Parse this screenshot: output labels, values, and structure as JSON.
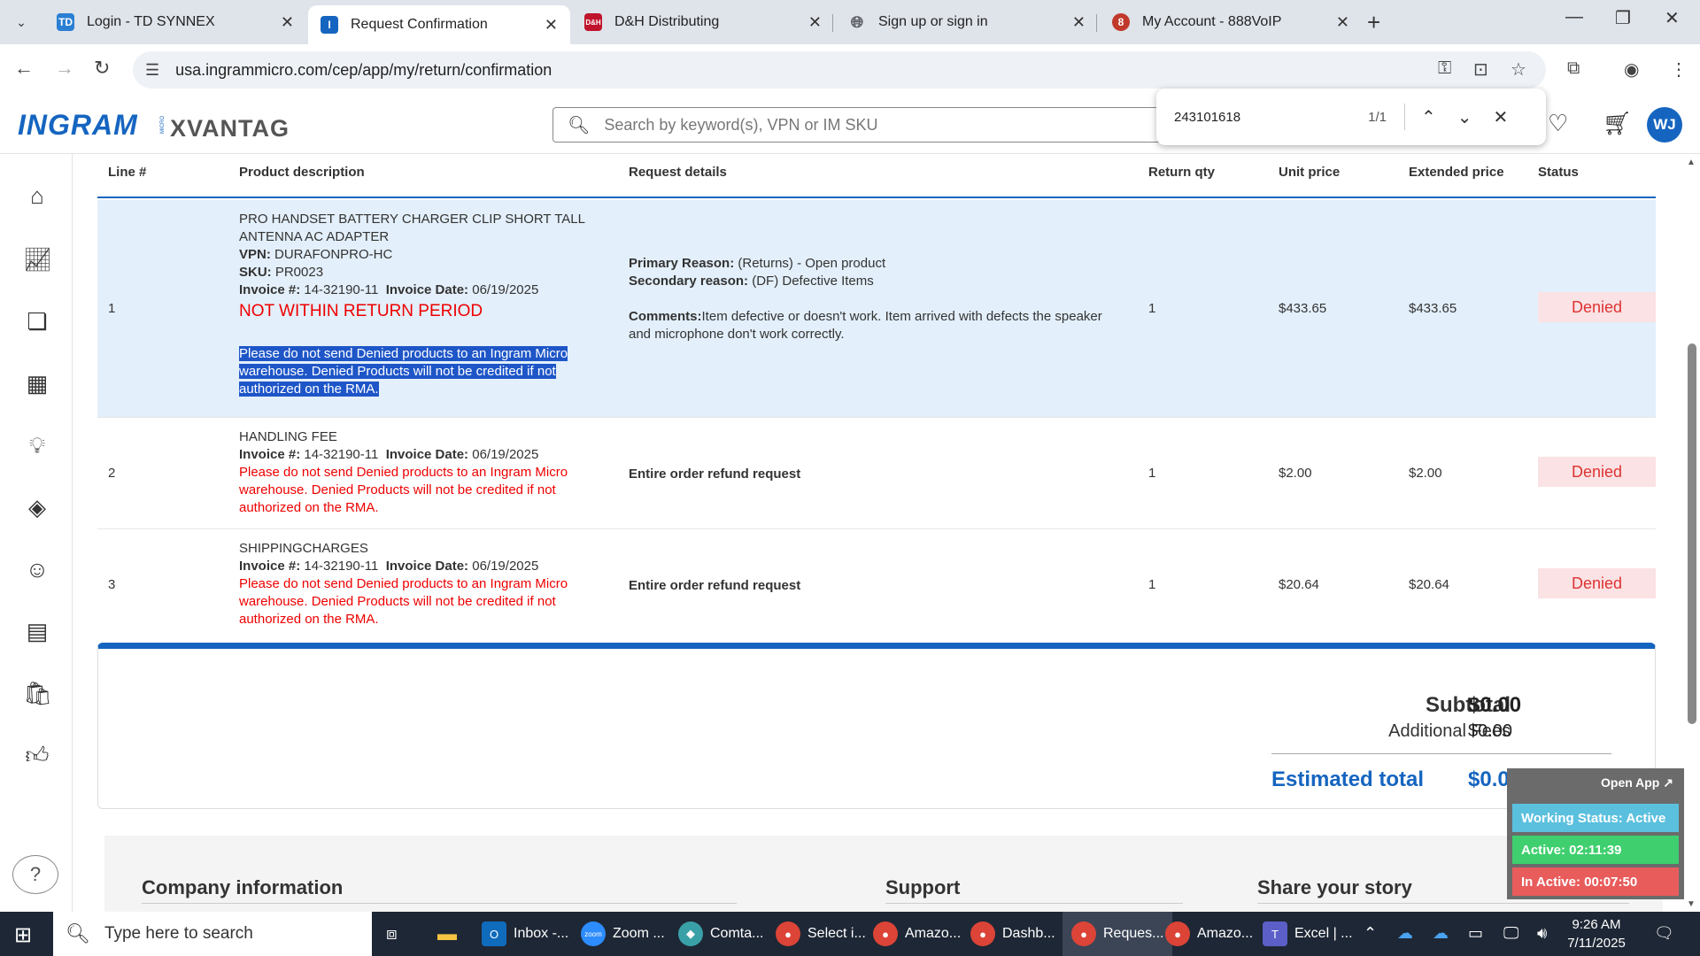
{
  "browser": {
    "tabs": [
      {
        "title": "Login - TD SYNNEX",
        "fav": "TD",
        "favcolor": "#2a7fd4"
      },
      {
        "title": "Request Confirmation",
        "fav": "I",
        "favcolor": "#1565c0"
      },
      {
        "title": "D&H Distributing",
        "fav": "D&H",
        "favcolor": "#c0142c"
      },
      {
        "title": "Sign up or sign in",
        "fav": "globe",
        "favcolor": "#5f6368"
      },
      {
        "title": "My Account - 888VoIP",
        "fav": "8",
        "favcolor": "#c0392b"
      }
    ],
    "url": "usa.ingrammicro.com/cep/app/my/return/confirmation"
  },
  "app": {
    "search_placeholder": "Search by keyword(s), VPN or IM SKU",
    "avatar": "WJ"
  },
  "find": {
    "query": "243101618",
    "count": "1/1"
  },
  "table": {
    "headers": {
      "line": "Line #",
      "desc": "Product description",
      "req": "Request details",
      "qty": "Return qty",
      "unit": "Unit price",
      "ext": "Extended price",
      "status": "Status"
    },
    "rows": [
      {
        "line": "1",
        "name": "PRO HANDSET BATTERY CHARGER CLIP SHORT TALL ANTENNA AC ADAPTER",
        "vpn_label": "VPN:",
        "vpn": "DURAFONPRO-HC",
        "sku_label": "SKU:",
        "sku": "PR0023",
        "inv_label": "Invoice #:",
        "inv": "14-32190-11",
        "date_label": "Invoice Date:",
        "date": "06/19/2025",
        "period": "NOT WITHIN RETURN PERIOD",
        "warning": "Please do not send Denied products to an Ingram Micro warehouse. Denied Products will not be credited if not authorized on the RMA.",
        "primary_label": "Primary Reason:",
        "primary": "(Returns) - Open product",
        "secondary_label": "Secondary reason:",
        "secondary": "(DF) Defective Items",
        "comments_label": "Comments:",
        "comments": "Item defective or doesn't work. Item arrived with defects the speaker and microphone don't work correctly.",
        "qty": "1",
        "unit": "$433.65",
        "ext": "$433.65",
        "status": "Denied"
      },
      {
        "line": "2",
        "name": "HANDLING FEE",
        "inv_label": "Invoice #:",
        "inv": "14-32190-11",
        "date_label": "Invoice Date:",
        "date": "06/19/2025",
        "warning": "Please do not send Denied products to an Ingram Micro warehouse. Denied Products will not be credited if not authorized on the RMA.",
        "request": "Entire order refund request",
        "qty": "1",
        "unit": "$2.00",
        "ext": "$2.00",
        "status": "Denied"
      },
      {
        "line": "3",
        "name": "SHIPPINGCHARGES",
        "inv_label": "Invoice #:",
        "inv": "14-32190-11",
        "date_label": "Invoice Date:",
        "date": "06/19/2025",
        "warning": "Please do not send Denied products to an Ingram Micro warehouse. Denied Products will not be credited if not authorized on the RMA.",
        "request": "Entire order refund request",
        "qty": "1",
        "unit": "$20.64",
        "ext": "$20.64",
        "status": "Denied"
      }
    ]
  },
  "totals": {
    "subtotal_label": "Subtotal",
    "subtotal": "$0.00",
    "fees_label": "Additional Fees",
    "fees": "$0.00",
    "est_label": "Estimated total",
    "est": "$0.00"
  },
  "footer": {
    "company": "Company information",
    "support": "Support",
    "story": "Share your story"
  },
  "widget": {
    "open": "Open App ↗",
    "status": "Working Status: Active",
    "active": "Active: 02:11:39",
    "inactive": "In Active: 00:07:50"
  },
  "taskbar": {
    "search": "Type here to search",
    "items": [
      {
        "label": "Inbox -...",
        "icon": "O",
        "color": "#0f6cbd"
      },
      {
        "label": "Zoom ...",
        "icon": "zoom",
        "color": "#2d8cff"
      },
      {
        "label": "Comta...",
        "icon": "◆",
        "color": "#3aa0a8"
      },
      {
        "label": "Select i...",
        "icon": "●",
        "color": "#db4437"
      },
      {
        "label": "Amazo...",
        "icon": "●",
        "color": "#db4437"
      },
      {
        "label": "Dashb...",
        "icon": "●",
        "color": "#db4437"
      },
      {
        "label": "Reques...",
        "icon": "●",
        "color": "#db4437"
      },
      {
        "label": "Amazo...",
        "icon": "●",
        "color": "#db4437"
      },
      {
        "label": "Excel | ...",
        "icon": "T",
        "color": "#5b5fc7"
      }
    ],
    "time": "9:26 AM",
    "date": "7/11/2025"
  }
}
